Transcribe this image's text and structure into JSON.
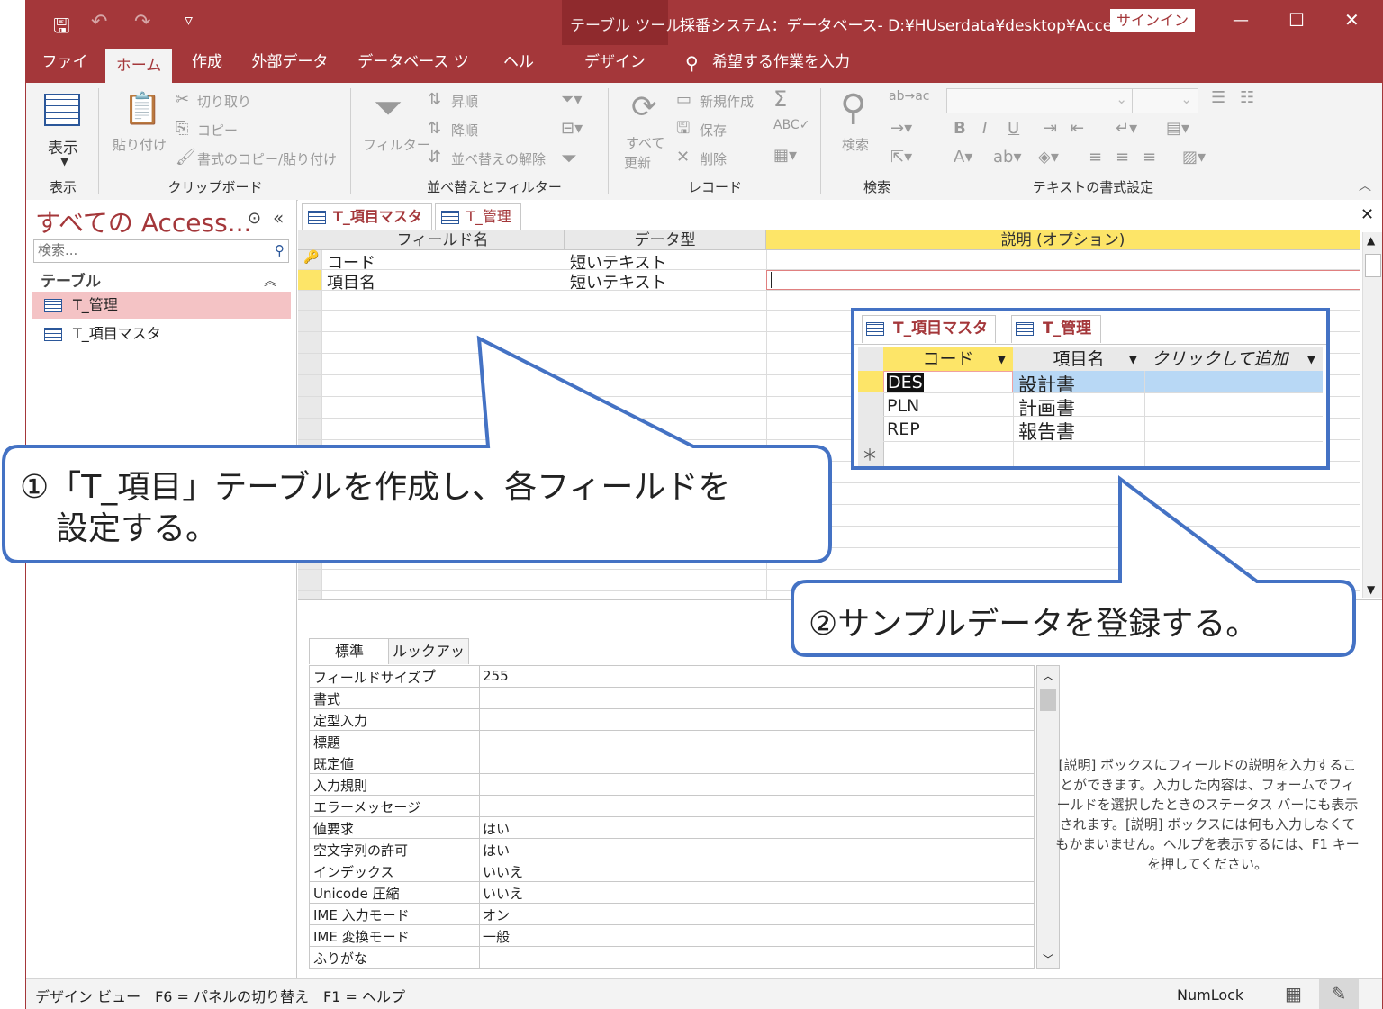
{
  "titlebar": {
    "context_tab": "テーブル ツール",
    "title": "採番システム：データベース- D:¥HUserdata¥desktop¥Acce···",
    "signin": "サインイン",
    "minimize": "—",
    "maximize": "☐",
    "close": "✕"
  },
  "tabs": {
    "file": "ファイル",
    "home": "ホーム",
    "create": "作成",
    "external": "外部データ",
    "dbtools": "データベース ツール",
    "help": "ヘルプ",
    "design": "デザイン",
    "tellme": "希望する作業を入力"
  },
  "ribbon": {
    "view_btn": "表示",
    "view_group": "表示",
    "paste": "貼り付け",
    "cut": "切り取り",
    "copy": "コピー",
    "format_painter": "書式のコピー/貼り付け",
    "clipboard_group": "クリップボード",
    "filter": "フィルター",
    "asc": "昇順",
    "desc": "降順",
    "clear_sort": "並べ替えの解除",
    "sort_group": "並べ替えとフィルター",
    "refresh_1": "すべて",
    "refresh_2": "更新",
    "new": "新規作成",
    "save": "保存",
    "delete": "削除",
    "records_group": "レコード",
    "find": "検索",
    "find_group": "検索",
    "text_group": "テキストの書式設定"
  },
  "nav": {
    "title": "すべての Access...",
    "search_placeholder": "検索...",
    "section": "テーブル",
    "items": [
      {
        "label": "T_管理",
        "selected": true
      },
      {
        "label": "T_項目マスタ",
        "selected": false
      }
    ]
  },
  "doc_tabs": [
    {
      "label": "T_項目マスタ"
    },
    {
      "label": "T_管理"
    }
  ],
  "design_grid": {
    "headers": [
      "フィールド名",
      "データ型",
      "説明 (オプション)"
    ],
    "rows": [
      {
        "field": "コード",
        "type": "短いテキスト",
        "desc": "",
        "key": true
      },
      {
        "field": "項目名",
        "type": "短いテキスト",
        "desc": "",
        "key": false
      }
    ]
  },
  "props": {
    "tabs": [
      "標準",
      "ルックアップ"
    ],
    "rows": [
      {
        "name": "フィールドサイズ",
        "value": "255"
      },
      {
        "name": "書式",
        "value": ""
      },
      {
        "name": "定型入力",
        "value": ""
      },
      {
        "name": "標題",
        "value": ""
      },
      {
        "name": "既定値",
        "value": ""
      },
      {
        "name": "入力規則",
        "value": ""
      },
      {
        "name": "エラーメッセージ",
        "value": ""
      },
      {
        "name": "値要求",
        "value": "はい"
      },
      {
        "name": "空文字列の許可",
        "value": "はい"
      },
      {
        "name": "インデックス",
        "value": "いいえ"
      },
      {
        "name": "Unicode 圧縮",
        "value": "いいえ"
      },
      {
        "name": "IME 入力モード",
        "value": "オン"
      },
      {
        "name": "IME 変換モード",
        "value": "一般"
      },
      {
        "name": "ふりがな",
        "value": ""
      }
    ],
    "help": "[説明] ボックスにフィールドの説明を入力することができます。入力した内容は、フォームでフィールドを選択したときのステータス バーにも表示されます。[説明] ボックスには何も入力しなくてもかまいません。ヘルプを表示するには、F1 キーを押してください。"
  },
  "status": {
    "left": "デザイン ビュー　F6 = パネルの切り替え　F1 = ヘルプ",
    "numlock": "NumLock"
  },
  "inset": {
    "tabs": [
      "T_項目マスタ",
      "T_管理"
    ],
    "headers": [
      "コード",
      "項目名",
      "クリックして追加"
    ],
    "rows": [
      {
        "code": "DES",
        "name": "設計書"
      },
      {
        "code": "PLN",
        "name": "計画書"
      },
      {
        "code": "REP",
        "name": "報告書"
      }
    ],
    "new_row_marker": "＊"
  },
  "callouts": {
    "one_line1": "①「T_項目」テーブルを作成し、各フィールドを",
    "one_line2": "設定する。",
    "two": "②サンプルデータを登録する。"
  },
  "colors": {
    "access_red": "#a4373a",
    "callout_blue": "#4472c4",
    "header_yellow": "#fde568",
    "selection_blue": "#b8d8f5"
  }
}
